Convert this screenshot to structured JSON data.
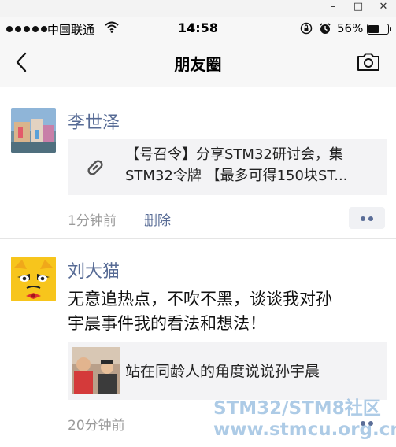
{
  "window": {
    "minimize": "–",
    "maximize": "□",
    "close": "✕"
  },
  "status_bar": {
    "carrier": "中国联通",
    "time": "14:58",
    "battery": "56%",
    "icons": [
      "signal-dots-icon",
      "wifi-icon",
      "rotation-lock-icon",
      "alarm-icon",
      "battery-icon"
    ]
  },
  "nav": {
    "title": "朋友圈",
    "back_icon": "chevron-left-icon",
    "camera_icon": "camera-icon"
  },
  "posts": [
    {
      "author": "李世泽",
      "link_title_line1": "【号召令】分享STM32研讨会，集",
      "link_title_line2": "STM32令牌 【最多可得150块ST...",
      "link_icon": "link-icon",
      "time": "1分钟前",
      "delete_label": "删除"
    },
    {
      "author": "刘大猫",
      "text_line1": "无意追热点，不吹不黑，谈谈我对孙",
      "text_line2": "宇晨事件我的看法和想法！",
      "link_title": "站在同龄人的角度说说孙宇晨",
      "time": "20分钟前"
    }
  ],
  "watermark": {
    "line1": "STM32/STM8社区",
    "line2": "www.stmcu.org.cn"
  }
}
